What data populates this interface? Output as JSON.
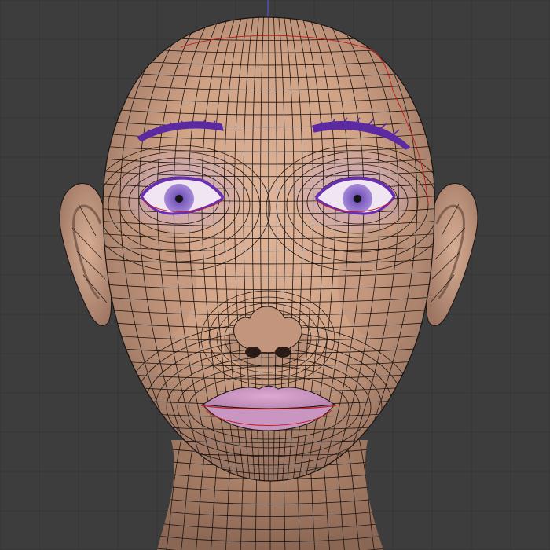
{
  "viewport": {
    "background_color": "#3d3d3d",
    "grid_line_color": "#353535",
    "axis_line_color": "#4b4fb8"
  },
  "mesh": {
    "skin_color": "#d3a88e",
    "skin_shadow_color": "#9a7463",
    "wire_color": "#1a1512",
    "seam_color": "#c02020"
  },
  "eyes": {
    "iris_color": "#8a67c9",
    "pupil_color": "#141414",
    "lid_color": "#6a2fb0",
    "socket_color": "#c9a6d6"
  },
  "brows": {
    "color": "#5b2aa0"
  },
  "lips": {
    "color": "#c996c2",
    "seam_color": "#c02020"
  }
}
